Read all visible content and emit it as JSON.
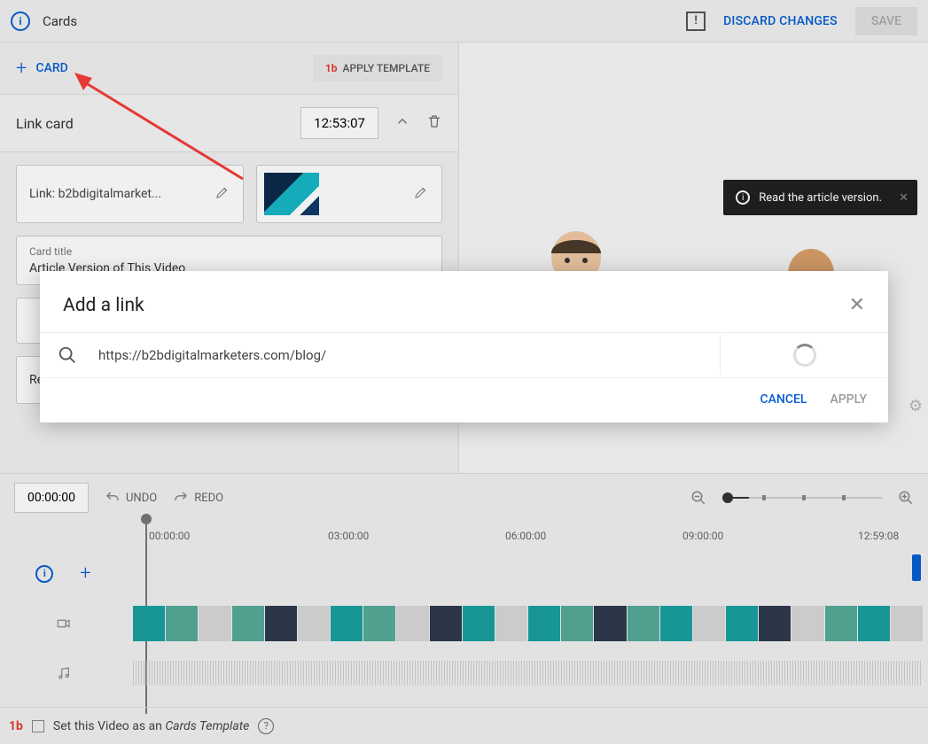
{
  "topbar": {
    "title": "Cards",
    "discard": "DISCARD CHANGES",
    "save": "SAVE"
  },
  "panel": {
    "add_card": "CARD",
    "apply_template": "APPLY TEMPLATE"
  },
  "card": {
    "type_name": "Link card",
    "timestamp": "12:53:07",
    "link_label": "Link: b2bdigitalmarket...",
    "title_label": "Card title",
    "title_value": "Article Version of This Video",
    "teaser_value": "Read the article version."
  },
  "preview": {
    "tooltip": "Read the article version."
  },
  "modal": {
    "title": "Add a link",
    "url": "https://b2bdigitalmarketers.com/blog/",
    "cancel": "CANCEL",
    "apply": "APPLY"
  },
  "timeline": {
    "current": "00:00:00",
    "undo": "UNDO",
    "redo": "REDO",
    "ticks": [
      "00:00:00",
      "03:00:00",
      "06:00:00",
      "09:00:00",
      "12:59:08"
    ]
  },
  "footer": {
    "label_pre": "Set this Video as an ",
    "label_em": "Cards Template"
  }
}
